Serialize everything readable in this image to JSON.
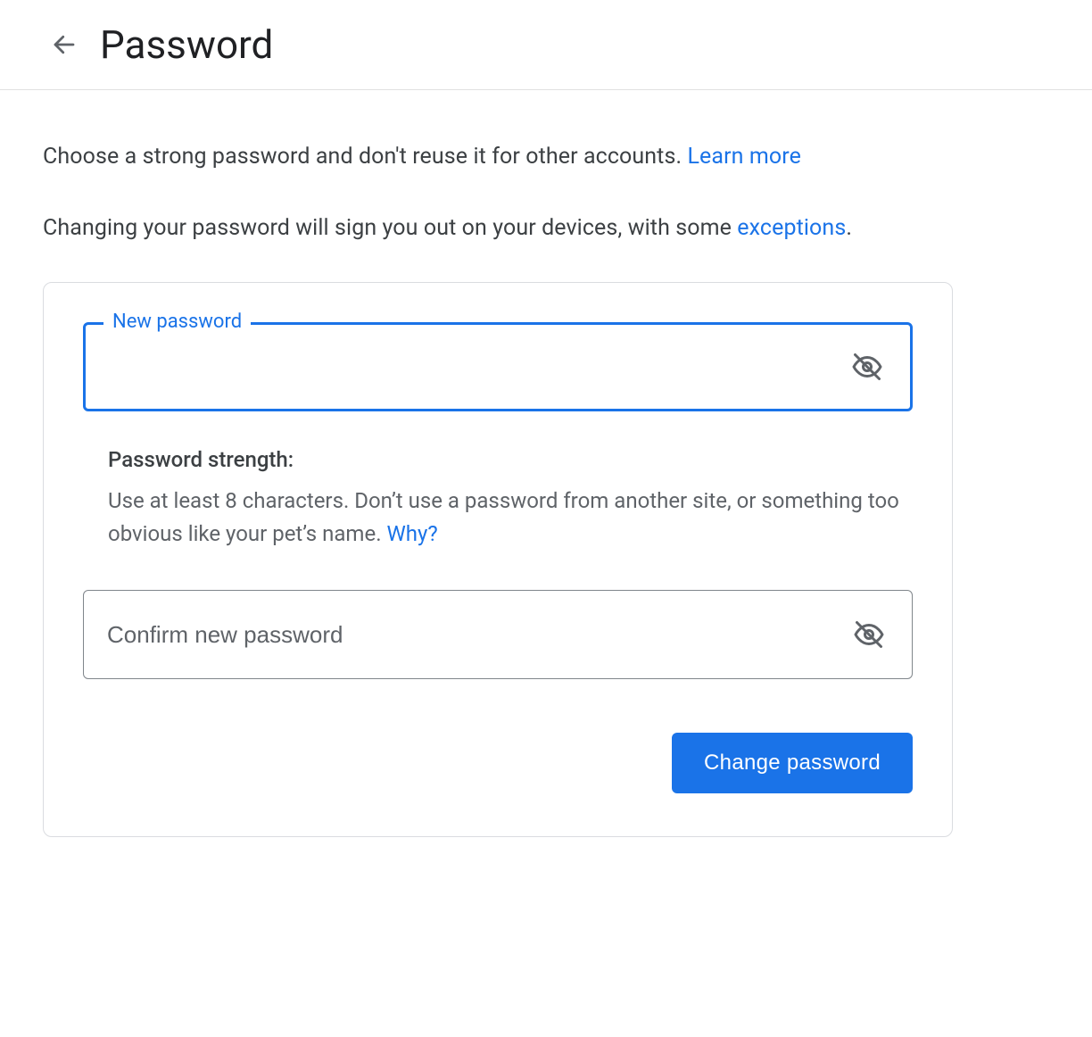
{
  "header": {
    "title": "Password"
  },
  "intro": {
    "line1_before": "Choose a strong password and don't reuse it for other accounts. ",
    "line1_link": "Learn more",
    "line2_before": "Changing your password will sign you out on your devices, with some ",
    "line2_link": "exceptions",
    "line2_after": "."
  },
  "form": {
    "new_password_label": "New password",
    "new_password_value": "",
    "strength_title": "Password strength:",
    "strength_body_before": "Use at least 8 characters. Don’t use a password from another site, or something too obvious like your pet’s name. ",
    "strength_body_link": "Why?",
    "confirm_placeholder": "Confirm new password",
    "confirm_value": "",
    "submit_label": "Change password"
  }
}
